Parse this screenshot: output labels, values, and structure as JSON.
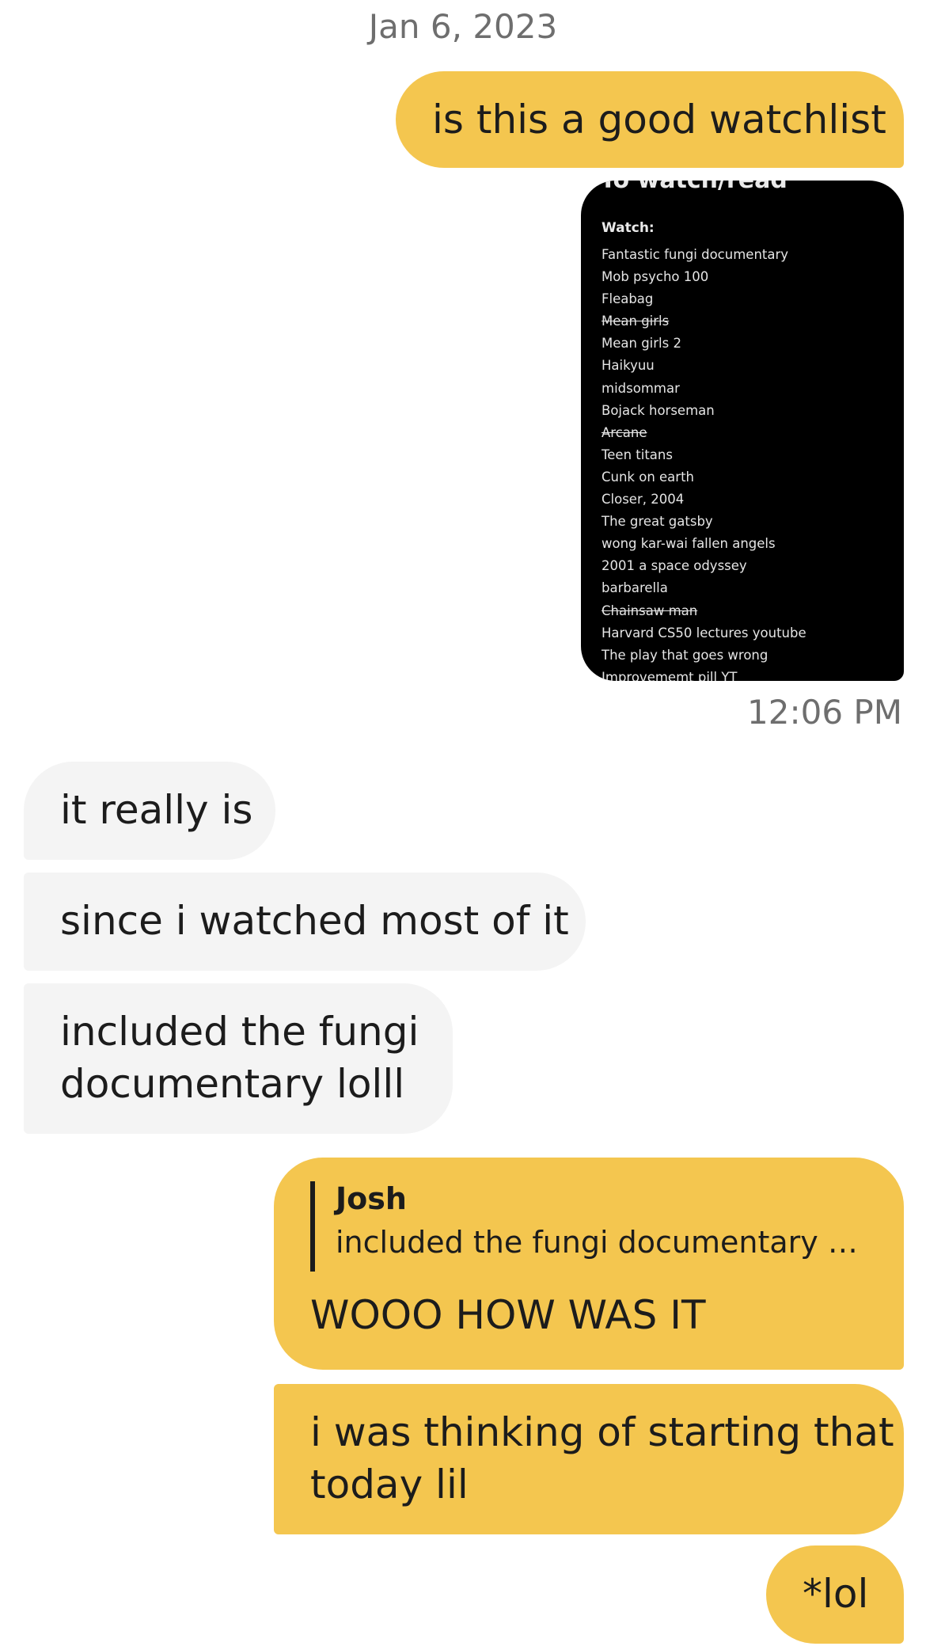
{
  "conversation": {
    "date_header": "Jan 6, 2023",
    "messages": [
      {
        "id": "m1",
        "direction": "outgoing",
        "text": "is this a good watchlist"
      },
      {
        "id": "m2",
        "direction": "outgoing",
        "type": "image",
        "image": {
          "title": "To watch/read",
          "heading": "Watch:",
          "items": [
            {
              "text": "Fantastic fungi documentary",
              "struck": false
            },
            {
              "text": "Mob psycho 100",
              "struck": false
            },
            {
              "text": "Fleabag",
              "struck": false
            },
            {
              "text": "Mean girls",
              "struck": true
            },
            {
              "text": "Mean girls 2",
              "struck": false
            },
            {
              "text": "Haikyuu",
              "struck": false
            },
            {
              "text": "midsommar",
              "struck": false
            },
            {
              "text": "Bojack horseman",
              "struck": false
            },
            {
              "text": "Arcane",
              "struck": true
            },
            {
              "text": "Teen titans",
              "struck": false
            },
            {
              "text": "Cunk on earth",
              "struck": false
            },
            {
              "text": "Closer, 2004",
              "struck": false
            },
            {
              "text": "The great gatsby",
              "struck": false
            },
            {
              "text": "wong kar-wai fallen angels",
              "struck": false
            },
            {
              "text": "2001 a space odyssey",
              "struck": false
            },
            {
              "text": "barbarella",
              "struck": false
            },
            {
              "text": "Chainsaw man",
              "struck": true
            },
            {
              "text": "Harvard CS50 lectures youtube",
              "struck": false
            },
            {
              "text": "The play that goes wrong",
              "struck": false
            },
            {
              "text": "Improvememt pill YT",
              "struck": false
            }
          ]
        }
      },
      {
        "id": "t1",
        "type": "timestamp",
        "text": "12:06 PM"
      },
      {
        "id": "m3",
        "direction": "incoming",
        "text": "it really is"
      },
      {
        "id": "m4",
        "direction": "incoming",
        "text": "since i watched most of it"
      },
      {
        "id": "m5",
        "direction": "incoming",
        "lines": [
          "included the fungi",
          "documentary lolll"
        ]
      },
      {
        "id": "m6",
        "direction": "outgoing",
        "reply_to": {
          "author": "Josh",
          "text": "included the fungi documentary l..."
        },
        "text": "WOOO HOW WAS IT"
      },
      {
        "id": "m7",
        "direction": "outgoing",
        "lines": [
          "i was thinking of starting that",
          "today lil"
        ]
      },
      {
        "id": "m8",
        "direction": "outgoing",
        "text": "*lol"
      }
    ]
  },
  "colors": {
    "outgoing_bubble": "#f4c64f",
    "incoming_bubble": "#f4f4f4",
    "meta_text": "#6e6e6e",
    "body_text": "#1c1c1c"
  }
}
